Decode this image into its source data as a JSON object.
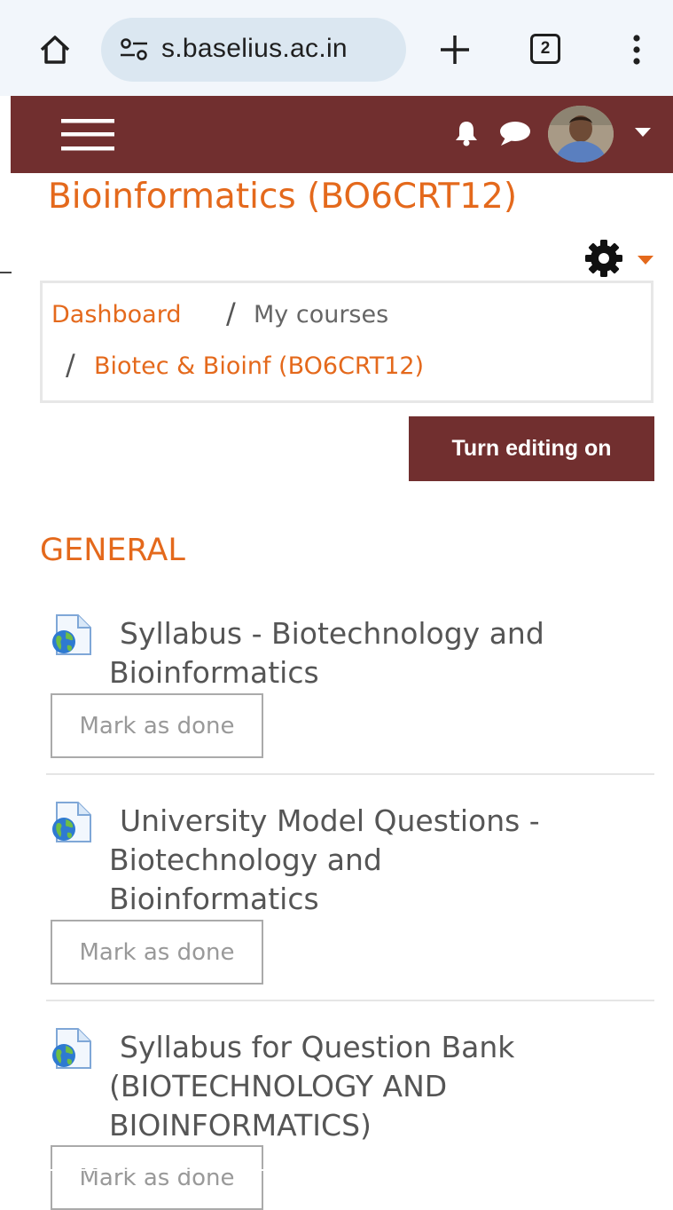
{
  "browser": {
    "url": "s.baselius.ac.in",
    "tab_count": "2"
  },
  "course": {
    "title": "Bioinformatics (BO6CRT12)"
  },
  "breadcrumb": {
    "items": [
      "Dashboard",
      "My courses",
      "Biotec & Bioinf (BO6CRT12)"
    ],
    "separator": "/"
  },
  "buttons": {
    "turn_editing": "Turn editing on",
    "mark_done": "Mark as done"
  },
  "section": {
    "title": "GENERAL"
  },
  "activities": [
    {
      "line1": "Syllabus - Biotechnology and",
      "line2": "Bioinformatics",
      "line3": ""
    },
    {
      "line1": "University Model Questions -",
      "line2": "Biotechnology and",
      "line3": "Bioinformatics"
    },
    {
      "line1": "Syllabus for Question Bank",
      "line2": "(BIOTECHNOLOGY AND",
      "line3": "BIOINFORMATICS)"
    }
  ],
  "colors": {
    "navbar": "#712f2f",
    "accent": "#e4691c",
    "chrome": "#f2f6fb",
    "urlbar": "#dbe7f1"
  },
  "icons": [
    "home-icon",
    "site-settings-icon",
    "new-tab-icon",
    "tab-switcher-icon",
    "more-menu-icon",
    "hamburger-icon",
    "bell-icon",
    "chat-icon",
    "gear-icon",
    "url-resource-icon"
  ]
}
